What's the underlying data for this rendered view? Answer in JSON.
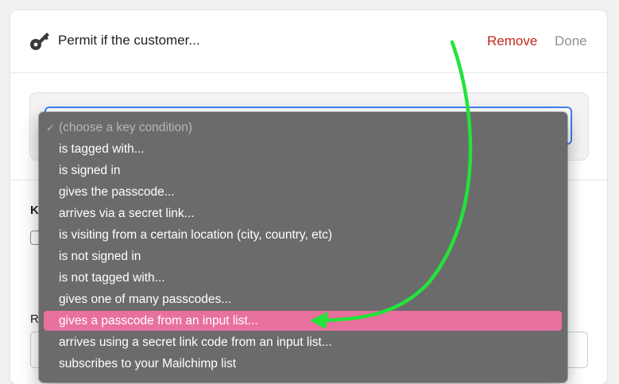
{
  "header": {
    "title": "Permit if the customer...",
    "remove_label": "Remove",
    "done_label": "Done",
    "icon": "key-icon"
  },
  "background": {
    "label_k": "K",
    "label_r": "R"
  },
  "dropdown": {
    "selected_marker": "✓",
    "highlighted_index": 9,
    "options": [
      "(choose a key condition)",
      "is tagged with...",
      "is signed in",
      "gives the passcode...",
      "arrives via a secret link...",
      "is visiting from a certain location (city, country, etc)",
      "is not signed in",
      "is not tagged with...",
      "gives one of many passcodes...",
      "gives a passcode from an input list...",
      "arrives using a secret link code from an input list...",
      "subscribes to your Mailchimp list"
    ]
  },
  "colors": {
    "remove": "#c5281c",
    "done": "#8c9196",
    "focus_ring": "#3b82f6",
    "menu_bg": "#6b6b6b",
    "highlight": "#e8709f",
    "annotation_arrow": "#22e33a"
  }
}
